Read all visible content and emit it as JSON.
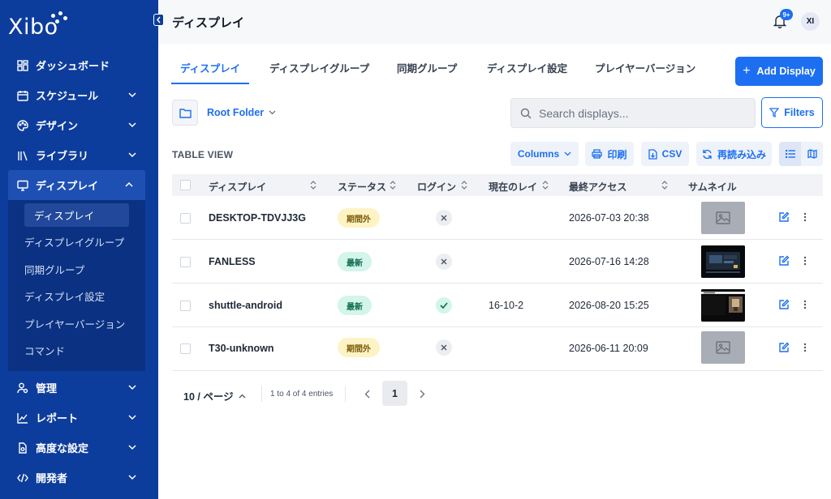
{
  "app": {
    "logo_text": "Xibo"
  },
  "sidebar": {
    "items": [
      {
        "label": "ダッシュボード",
        "icon": "dashboard-icon",
        "has_chevron": false
      },
      {
        "label": "スケジュール",
        "icon": "calendar-icon",
        "has_chevron": true
      },
      {
        "label": "デザイン",
        "icon": "palette-icon",
        "has_chevron": true
      },
      {
        "label": "ライブラリ",
        "icon": "library-icon",
        "has_chevron": true
      },
      {
        "label": "ディスプレイ",
        "icon": "monitor-icon",
        "has_chevron": true,
        "active": true
      }
    ],
    "display_subitems": [
      {
        "label": "ディスプレイ",
        "active": true
      },
      {
        "label": "ディスプレイグループ"
      },
      {
        "label": "同期グループ"
      },
      {
        "label": "ディスプレイ設定"
      },
      {
        "label": "プレイヤーバージョン"
      },
      {
        "label": "コマンド"
      }
    ],
    "lower_items": [
      {
        "label": "管理",
        "icon": "user-gear-icon"
      },
      {
        "label": "レポート",
        "icon": "chart-icon"
      },
      {
        "label": "高度な設定",
        "icon": "file-settings-icon"
      },
      {
        "label": "開発者",
        "icon": "code-icon"
      }
    ]
  },
  "header": {
    "title": "ディスプレイ",
    "notification_badge": "9+",
    "avatar_initials": "XI"
  },
  "tabs": [
    {
      "label": "ディスプレイ",
      "active": true
    },
    {
      "label": "ディスプレイグループ"
    },
    {
      "label": "同期グループ"
    },
    {
      "label": "ディスプレイ設定"
    },
    {
      "label": "プレイヤーバージョン"
    }
  ],
  "actions": {
    "add_display_label": "Add Display",
    "filters_label": "Filters"
  },
  "folder": {
    "label": "Root Folder"
  },
  "search": {
    "placeholder": "Search displays..."
  },
  "toolbar": {
    "table_view_label": "TABLE VIEW",
    "columns_label": "Columns",
    "print_label": "印刷",
    "csv_label": "CSV",
    "reload_label": "再読み込み"
  },
  "table": {
    "columns": [
      "ディスプレイ",
      "ステータス",
      "ログイン",
      "現在のレイ",
      "最終アクセス",
      "サムネイル"
    ],
    "rows": [
      {
        "name": "DESKTOP-TDVJJ3G",
        "status": "期間外",
        "status_type": "expired",
        "logged_in": false,
        "layout": "",
        "last_access": "2026-07-03 20:38",
        "thumbnail": "placeholder"
      },
      {
        "name": "FANLESS",
        "status": "最新",
        "status_type": "latest",
        "logged_in": false,
        "layout": "",
        "last_access": "2026-07-16 14:28",
        "thumbnail": "screenshot"
      },
      {
        "name": "shuttle-android",
        "status": "最新",
        "status_type": "latest",
        "logged_in": true,
        "layout": "16-10-2",
        "last_access": "2026-08-20 15:25",
        "thumbnail": "screenshot"
      },
      {
        "name": "T30-unknown",
        "status": "期間外",
        "status_type": "expired",
        "logged_in": false,
        "layout": "",
        "last_access": "2026-06-11 20:09",
        "thumbnail": "placeholder"
      }
    ]
  },
  "pagination": {
    "page_size_label": "10 / ページ",
    "info": "1 to 4 of 4 entries",
    "current_page": "1"
  },
  "colors": {
    "sidebar_bg": "#0d3d9c",
    "accent": "#1d6ff2",
    "expired_badge": "#fdf3c4",
    "latest_badge": "#d3f5ea"
  }
}
